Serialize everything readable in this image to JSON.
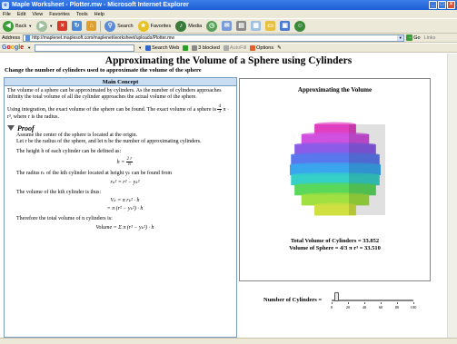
{
  "window": {
    "title": "Maple Worksheet - Plotter.mw - Microsoft Internet Explorer"
  },
  "menu": [
    "File",
    "Edit",
    "View",
    "Favorites",
    "Tools",
    "Help"
  ],
  "toolbar": {
    "back": "Back",
    "search": "Search",
    "favorites": "Favorites",
    "media": "Media"
  },
  "address": {
    "label": "Address",
    "url": "http://maplenet.maplesoft.com/maplenet/worksheet/uploads/Plotter.mw",
    "go": "Go",
    "links": "Links"
  },
  "googlebar": {
    "search_web": "Search Web",
    "blocked": "3 blocked",
    "autofill": "AutoFill",
    "options": "Options"
  },
  "page": {
    "title": "Approximating the Volume of a Sphere using Cylinders",
    "subtitle": "Change the number of cylinders used to approximate the volume of the sphere"
  },
  "concept": {
    "heading": "Main Concept",
    "p1": "The volume of a sphere can be approximated by cylinders. As the number of cylinders approaches infinity the total volume of all the cylinder approaches the actual volume of the sphere.",
    "p2": "Using integration, the exact volume of the sphere can be found. The exact volume of a sphere is",
    "p2_tail": "π · r³, where r is the radius.",
    "frac_num": "4",
    "frac_den": "3",
    "proof": "Proof",
    "proof_p1": "Assume the center of the sphere is located at the origin.",
    "proof_p2": "Let r be the radius of the sphere, and let n be the number of approximating cylinders.",
    "height_text": "The height h of each cylinder can be defined as:",
    "height_eq_lhs": "h =",
    "height_num": "2 r",
    "height_den": "n",
    "radius_text": "The radius rₖ of the kth cylinder located at height yₖ can be found from",
    "radius_eq": "rₖ² = r² − yₖ²",
    "volume_text": "The volume of the kth cylinder is thus:",
    "volume_eq1": "Vₖ = π rₖ² · h",
    "volume_eq2": "= π (r² − yₖ²) · h",
    "total_text": "Therefore the total volume of n cylinders is:",
    "total_eq": "Volume = Σ π (r² − yₖ²) · h"
  },
  "plot": {
    "title": "Approximating the Volume",
    "total_cylinders": "Total Volume of Cylinders = 33.852",
    "sphere_volume": "Volume of Sphere = 4/3 π r³ = 33.510"
  },
  "slider": {
    "label": "Number of Cylinders =",
    "ticks": [
      "0",
      "20",
      "40",
      "60",
      "80",
      "100"
    ],
    "value": 5
  },
  "colors": {
    "accent": "#1f5fd6",
    "panel_head": "#c8dcf2",
    "bands": [
      "#e040c0",
      "#d050e0",
      "#8a5ce8",
      "#5a78ee",
      "#3aa6ee",
      "#35d0c8",
      "#5ad85a",
      "#a0e040",
      "#d0e040"
    ]
  }
}
